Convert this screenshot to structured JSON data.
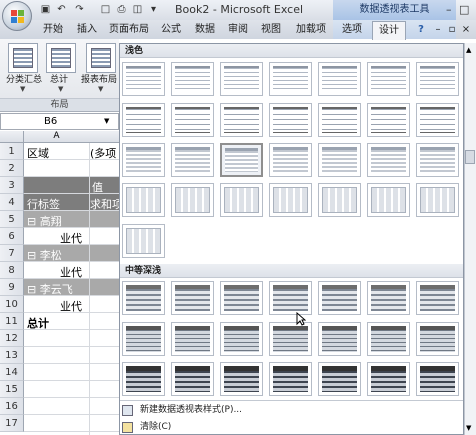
{
  "app": {
    "title": "Book2 - Microsoft Excel",
    "contextual_tab_group": "数据透视表工具"
  },
  "tabs": [
    "开始",
    "插入",
    "页面布局",
    "公式",
    "数据",
    "审阅",
    "视图",
    "加载项",
    "选项",
    "设计"
  ],
  "active_tab": "设计",
  "ribbon": {
    "buttons": [
      {
        "label": "分类汇总",
        "icon": "subtotals-icon"
      },
      {
        "label": "总计",
        "icon": "grand-totals-icon"
      },
      {
        "label": "报表布局",
        "icon": "report-layout-icon"
      }
    ],
    "group_label": "布局",
    "dropdown_caret": "▼"
  },
  "name_box": {
    "value": "B6"
  },
  "sheet": {
    "column_header": "A",
    "rows": [
      {
        "num": "1",
        "a": "区域",
        "b": "(多项"
      },
      {
        "num": "2",
        "a": "",
        "b": ""
      },
      {
        "num": "3",
        "a": "",
        "b": "值"
      },
      {
        "num": "4",
        "a": "行标签",
        "b": "求和项"
      },
      {
        "num": "5",
        "a": "⊟ 高翔",
        "b": ""
      },
      {
        "num": "6",
        "a": "业代",
        "b": ""
      },
      {
        "num": "7",
        "a": "⊟ 李松",
        "b": ""
      },
      {
        "num": "8",
        "a": "业代",
        "b": ""
      },
      {
        "num": "9",
        "a": "⊟ 李云飞",
        "b": ""
      },
      {
        "num": "10",
        "a": "业代",
        "b": ""
      },
      {
        "num": "11",
        "a": "总计",
        "b": ""
      },
      {
        "num": "12",
        "a": "",
        "b": ""
      },
      {
        "num": "13",
        "a": "",
        "b": ""
      },
      {
        "num": "14",
        "a": "",
        "b": ""
      },
      {
        "num": "15",
        "a": "",
        "b": ""
      },
      {
        "num": "16",
        "a": "",
        "b": ""
      },
      {
        "num": "17",
        "a": "",
        "b": ""
      }
    ]
  },
  "gallery": {
    "section_light": "浅色",
    "section_medium": "中等深浅",
    "menu": [
      {
        "label": "新建数据透视表样式(P)...",
        "icon": "new-style-icon"
      },
      {
        "label": "清除(C)",
        "icon": "clear-icon"
      }
    ]
  },
  "colors": {
    "pivot_header": "#7d7d7d",
    "selected_border": "#8f8f8f"
  }
}
